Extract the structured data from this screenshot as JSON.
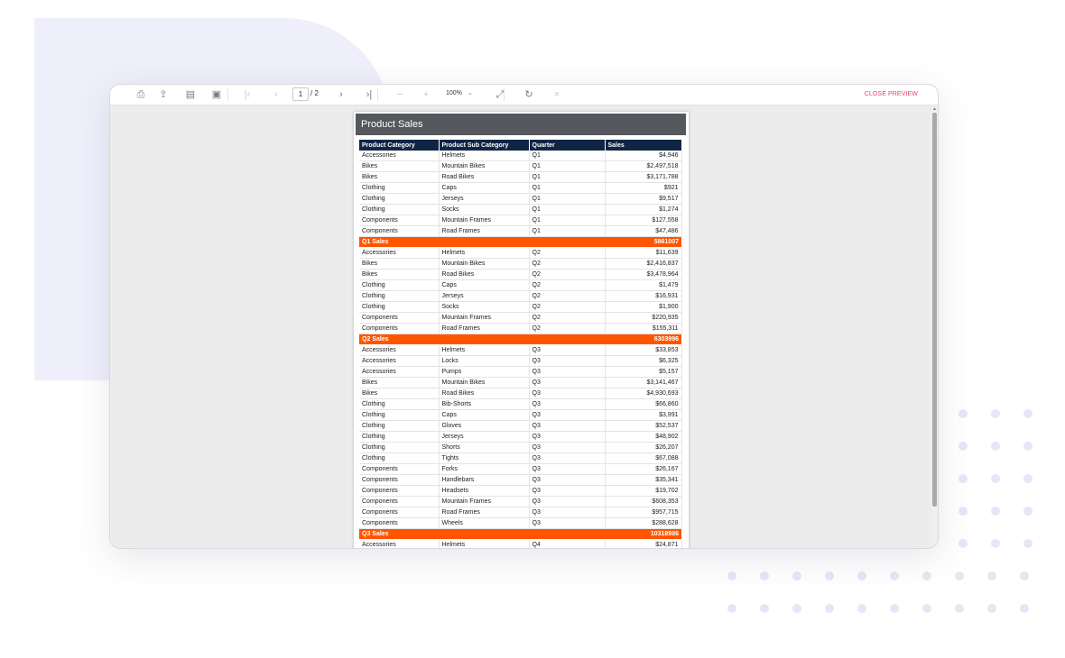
{
  "toolbar": {
    "buttons": [
      {
        "name": "print-icon",
        "glyph": "⎙"
      },
      {
        "name": "export-icon",
        "glyph": "⇪"
      },
      {
        "name": "page-setup-icon",
        "glyph": "▤"
      },
      {
        "name": "parameters-icon",
        "glyph": "▣"
      },
      {
        "name": "first-page-icon",
        "glyph": "|‹"
      },
      {
        "name": "previous-page-icon",
        "glyph": "‹"
      },
      {
        "name": "next-page-icon",
        "glyph": "›"
      },
      {
        "name": "last-page-icon",
        "glyph": "›|"
      },
      {
        "name": "zoom-out-icon",
        "glyph": "−"
      },
      {
        "name": "zoom-in-icon",
        "glyph": "+"
      },
      {
        "name": "fit-page-icon",
        "glyph": "⤢"
      },
      {
        "name": "refresh-icon",
        "glyph": "↻"
      },
      {
        "name": "stop-icon",
        "glyph": "×"
      }
    ],
    "current_page": "1",
    "total_pages": "/ 2",
    "zoom": "100%",
    "zoom_caret": "⌄",
    "close_preview": "CLOSE PREVIEW"
  },
  "report": {
    "title": "Product Sales",
    "columns": [
      "Product Category",
      "Product Sub Category",
      "Quarter",
      "Sales"
    ],
    "rows": [
      {
        "type": "row",
        "cells": [
          "Accessories",
          "Helmets",
          "Q1",
          "$4,946"
        ]
      },
      {
        "type": "row",
        "cells": [
          "Bikes",
          "Mountain Bikes",
          "Q1",
          "$2,497,518"
        ]
      },
      {
        "type": "row",
        "cells": [
          "Bikes",
          "Road Bikes",
          "Q1",
          "$3,171,788"
        ]
      },
      {
        "type": "row",
        "cells": [
          "Clothing",
          "Caps",
          "Q1",
          "$921"
        ]
      },
      {
        "type": "row",
        "cells": [
          "Clothing",
          "Jerseys",
          "Q1",
          "$9,517"
        ]
      },
      {
        "type": "row",
        "cells": [
          "Clothing",
          "Socks",
          "Q1",
          "$1,274"
        ]
      },
      {
        "type": "row",
        "cells": [
          "Components",
          "Mountain Frames",
          "Q1",
          "$127,558"
        ]
      },
      {
        "type": "row",
        "cells": [
          "Components",
          "Road Frames",
          "Q1",
          "$47,486"
        ]
      },
      {
        "type": "total",
        "label": "Q1 Sales",
        "value": "5861007"
      },
      {
        "type": "row",
        "cells": [
          "Accessories",
          "Helmets",
          "Q2",
          "$11,639"
        ]
      },
      {
        "type": "row",
        "cells": [
          "Bikes",
          "Mountain Bikes",
          "Q2",
          "$2,416,837"
        ]
      },
      {
        "type": "row",
        "cells": [
          "Bikes",
          "Road Bikes",
          "Q2",
          "$3,478,964"
        ]
      },
      {
        "type": "row",
        "cells": [
          "Clothing",
          "Caps",
          "Q2",
          "$1,479"
        ]
      },
      {
        "type": "row",
        "cells": [
          "Clothing",
          "Jerseys",
          "Q2",
          "$16,931"
        ]
      },
      {
        "type": "row",
        "cells": [
          "Clothing",
          "Socks",
          "Q2",
          "$1,900"
        ]
      },
      {
        "type": "row",
        "cells": [
          "Components",
          "Mountain Frames",
          "Q2",
          "$220,935"
        ]
      },
      {
        "type": "row",
        "cells": [
          "Components",
          "Road Frames",
          "Q2",
          "$155,311"
        ]
      },
      {
        "type": "total",
        "label": "Q2 Sales",
        "value": "6303996"
      },
      {
        "type": "row",
        "cells": [
          "Accessories",
          "Helmets",
          "Q3",
          "$33,853"
        ]
      },
      {
        "type": "row",
        "cells": [
          "Accessories",
          "Locks",
          "Q3",
          "$6,325"
        ]
      },
      {
        "type": "row",
        "cells": [
          "Accessories",
          "Pumps",
          "Q3",
          "$5,157"
        ]
      },
      {
        "type": "row",
        "cells": [
          "Bikes",
          "Mountain Bikes",
          "Q3",
          "$3,141,467"
        ]
      },
      {
        "type": "row",
        "cells": [
          "Bikes",
          "Road Bikes",
          "Q3",
          "$4,930,693"
        ]
      },
      {
        "type": "row",
        "cells": [
          "Clothing",
          "Bib-Shorts",
          "Q3",
          "$66,860"
        ]
      },
      {
        "type": "row",
        "cells": [
          "Clothing",
          "Caps",
          "Q3",
          "$3,991"
        ]
      },
      {
        "type": "row",
        "cells": [
          "Clothing",
          "Gloves",
          "Q3",
          "$52,537"
        ]
      },
      {
        "type": "row",
        "cells": [
          "Clothing",
          "Jerseys",
          "Q3",
          "$48,902"
        ]
      },
      {
        "type": "row",
        "cells": [
          "Clothing",
          "Shorts",
          "Q3",
          "$26,207"
        ]
      },
      {
        "type": "row",
        "cells": [
          "Clothing",
          "Tights",
          "Q3",
          "$67,088"
        ]
      },
      {
        "type": "row",
        "cells": [
          "Components",
          "Forks",
          "Q3",
          "$26,167"
        ]
      },
      {
        "type": "row",
        "cells": [
          "Components",
          "Handlebars",
          "Q3",
          "$35,341"
        ]
      },
      {
        "type": "row",
        "cells": [
          "Components",
          "Headsets",
          "Q3",
          "$19,702"
        ]
      },
      {
        "type": "row",
        "cells": [
          "Components",
          "Mountain Frames",
          "Q3",
          "$608,353"
        ]
      },
      {
        "type": "row",
        "cells": [
          "Components",
          "Road Frames",
          "Q3",
          "$957,715"
        ]
      },
      {
        "type": "row",
        "cells": [
          "Components",
          "Wheels",
          "Q3",
          "$288,628"
        ]
      },
      {
        "type": "total",
        "label": "Q3 Sales",
        "value": "10318986"
      },
      {
        "type": "row",
        "cells": [
          "Accessories",
          "Helmets",
          "Q4",
          "$24,871"
        ]
      }
    ]
  },
  "colors": {
    "header_bg": "#55595e",
    "table_header_bg": "#0f2544",
    "total_row_bg": "#ff5500",
    "close_preview": "#e8416c"
  }
}
